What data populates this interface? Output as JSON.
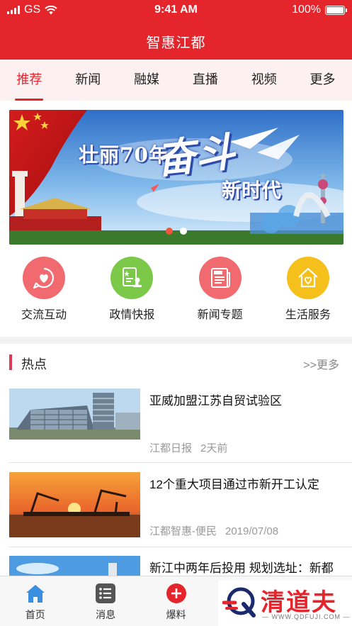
{
  "status_bar": {
    "carrier": "GS",
    "time": "9:41 AM",
    "battery": "100%"
  },
  "app": {
    "title": "智惠江都"
  },
  "tabs": [
    {
      "label": "推荐",
      "active": true
    },
    {
      "label": "新闻"
    },
    {
      "label": "融媒"
    },
    {
      "label": "直播"
    },
    {
      "label": "视频"
    },
    {
      "label": "更多"
    }
  ],
  "banner": {
    "headline_part1": "壮丽70年",
    "headline_part2": "奋斗",
    "headline_part3": "新时代",
    "slide_count": 2,
    "active_slide": 1
  },
  "quick_links": [
    {
      "label": "交流互动",
      "icon": "heart-chat-icon",
      "color": "#f16a6f"
    },
    {
      "label": "政情快报",
      "icon": "document-stamp-icon",
      "color": "#7cc94a"
    },
    {
      "label": "新闻专题",
      "icon": "newspaper-icon",
      "color": "#f16a6f"
    },
    {
      "label": "生活服务",
      "icon": "house-heart-icon",
      "color": "#f5bf1c"
    }
  ],
  "hot_section": {
    "title": "热点",
    "more": ">>更多"
  },
  "news": [
    {
      "title": "亚威加盟江苏自贸试验区",
      "source": "江都日报",
      "time": "2天前"
    },
    {
      "title": "12个重大项目通过市新开工认定",
      "source": "江都智惠-便民",
      "time": "2019/07/08"
    },
    {
      "title": "新江中两年后投用 规划选址：新都",
      "source": "",
      "time": ""
    }
  ],
  "bottom_nav": [
    {
      "label": "首页",
      "icon": "home-icon",
      "active": true
    },
    {
      "label": "消息",
      "icon": "list-icon"
    },
    {
      "label": "爆料",
      "icon": "plus-circle-icon"
    },
    {
      "label": "",
      "icon": "target-icon"
    },
    {
      "label": "",
      "icon": "user-icon"
    }
  ],
  "watermark": {
    "name": "清道夫",
    "url": "— WWW.QDFUJI.COM —"
  },
  "colors": {
    "brand_red": "#e5252c",
    "tab_bg": "#fdf0f0",
    "accent_bar": "#d93a54",
    "home_blue": "#3a8fe0"
  }
}
